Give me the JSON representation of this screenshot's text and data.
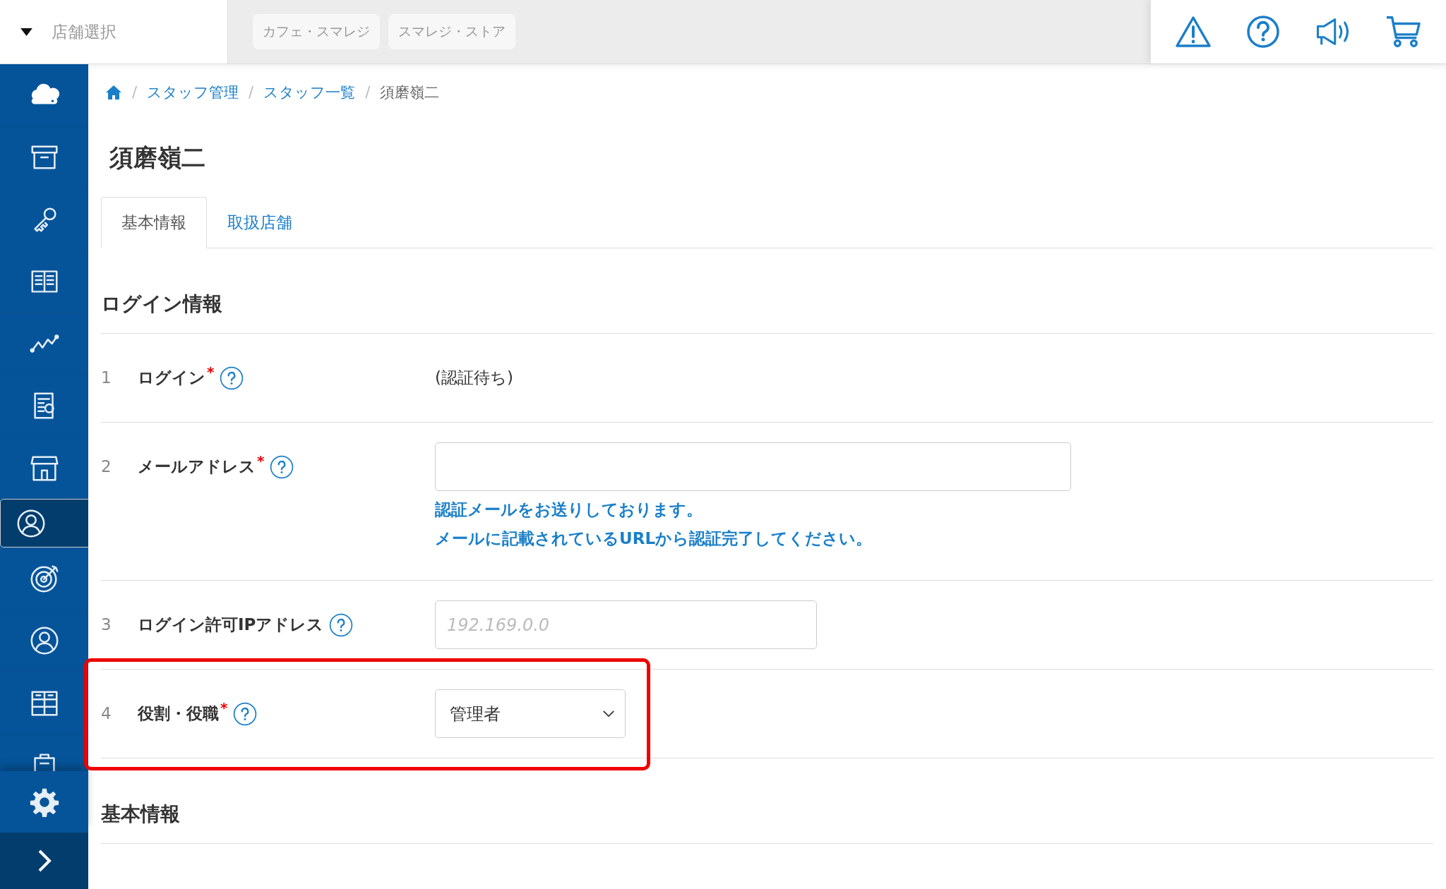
{
  "store_selector": {
    "label": "店舗選択"
  },
  "stores": [
    "カフェ・スマレジ",
    "スマレジ・ストア"
  ],
  "sidebar": {
    "items": [
      {
        "selected": false
      },
      {
        "selected": false
      },
      {
        "selected": false
      },
      {
        "selected": false
      },
      {
        "selected": false
      },
      {
        "selected": false
      },
      {
        "selected": false
      },
      {
        "selected": true
      },
      {
        "selected": false
      },
      {
        "selected": false
      },
      {
        "selected": false
      },
      {
        "selected": false
      }
    ]
  },
  "breadcrumb": [
    {
      "kind": "home"
    },
    {
      "kind": "separator",
      "text": "/"
    },
    {
      "kind": "link",
      "text": "スタッフ管理"
    },
    {
      "kind": "separator",
      "text": "/"
    },
    {
      "kind": "link",
      "text": "スタッフ一覧"
    },
    {
      "kind": "separator",
      "text": "/"
    },
    {
      "kind": "current",
      "text": "須磨嶺二"
    }
  ],
  "title": "須磨嶺二",
  "tabs": [
    {
      "label": "基本情報",
      "selected": true
    },
    {
      "label": "取扱店舗",
      "selected": false
    }
  ],
  "sections": [
    {
      "heading": "ログイン情報",
      "rows": [
        {
          "number": "1",
          "label": "ログイン",
          "mark": "*",
          "kind": "text",
          "value": "(認証待ち)",
          "highlighted": false
        },
        {
          "number": "2",
          "label": "メールアドレス",
          "mark": "*",
          "kind": "input",
          "notes": [
            "認証メールをお送りしております。",
            "メールに記載されているURLから認証完了してください。"
          ],
          "highlighted": false
        },
        {
          "number": "3",
          "label": "ログイン許可IPアドレス",
          "kind": "input",
          "placeholder": "192.169.0.0",
          "highlighted": false
        },
        {
          "number": "4",
          "label": "役割・役職",
          "mark": "*",
          "kind": "select",
          "value": "管理者",
          "highlighted": true
        }
      ]
    },
    {
      "heading": "基本情報"
    }
  ]
}
